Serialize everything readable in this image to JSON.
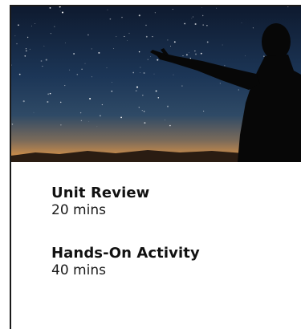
{
  "activities": [
    {
      "title": "Unit Review",
      "duration": "20 mins"
    },
    {
      "title": "Hands-On Activity",
      "duration": "40 mins"
    }
  ],
  "colors": {
    "sky_top": "#0f1a2e",
    "sky_mid": "#1f3a5c",
    "horizon_glow": "#c98a4a",
    "silhouette": "#0a0a0a",
    "border": "#1a1a1a",
    "text": "#111111"
  },
  "hero_image": {
    "subject": "person-pointing-at-stars-silhouette"
  }
}
